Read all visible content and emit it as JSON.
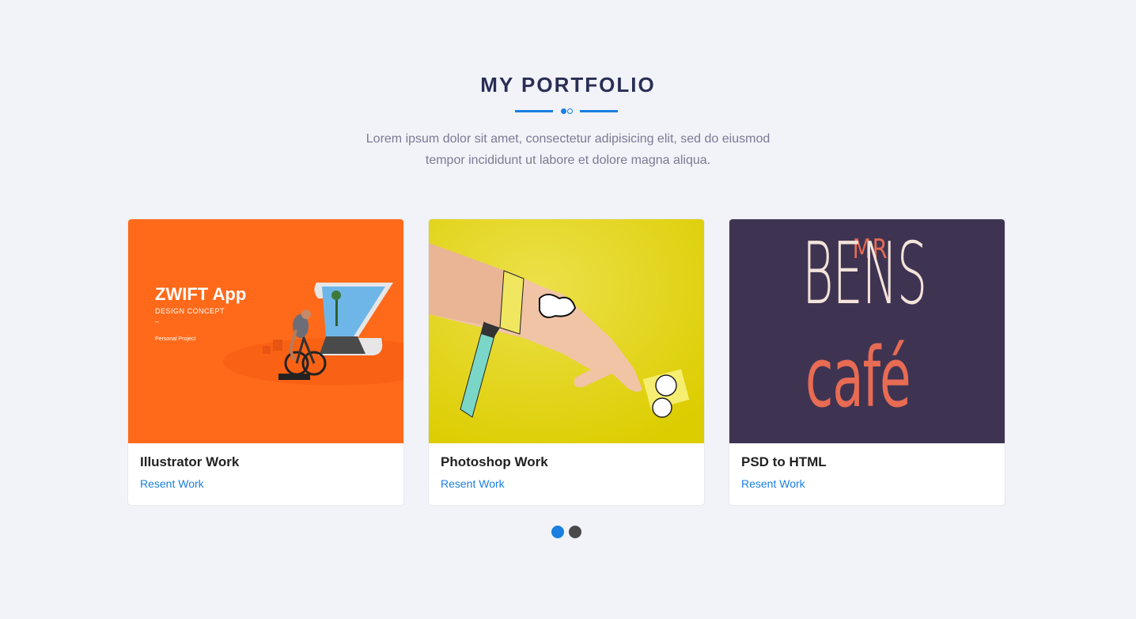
{
  "section": {
    "title": "MY PORTFOLIO",
    "subtitle": "Lorem ipsum dolor sit amet, consectetur adipisicing elit, sed do eiusmod tempor incididunt ut labore et dolore magna aliqua."
  },
  "cards": [
    {
      "title": "Illustrator Work",
      "link": "Resent Work",
      "image": {
        "headline": "ZWIFT App",
        "caption": "DESIGN CONCEPT",
        "dash": "–",
        "note": "Personal Project",
        "bg": "#ff6a1a"
      }
    },
    {
      "title": "Photoshop Work",
      "link": "Resent Work",
      "image": {
        "bg": "#e2d300"
      }
    },
    {
      "title": "PSD to HTML",
      "link": "Resent Work",
      "image": {
        "line1": "MR",
        "line2": "BENS",
        "line3": "café",
        "bg": "#3e3452"
      }
    }
  ],
  "pagination": {
    "pages": 2,
    "active": 1
  },
  "colors": {
    "accent": "#1a7fe0",
    "title": "#2a2e55",
    "background": "#f1f3f8"
  }
}
